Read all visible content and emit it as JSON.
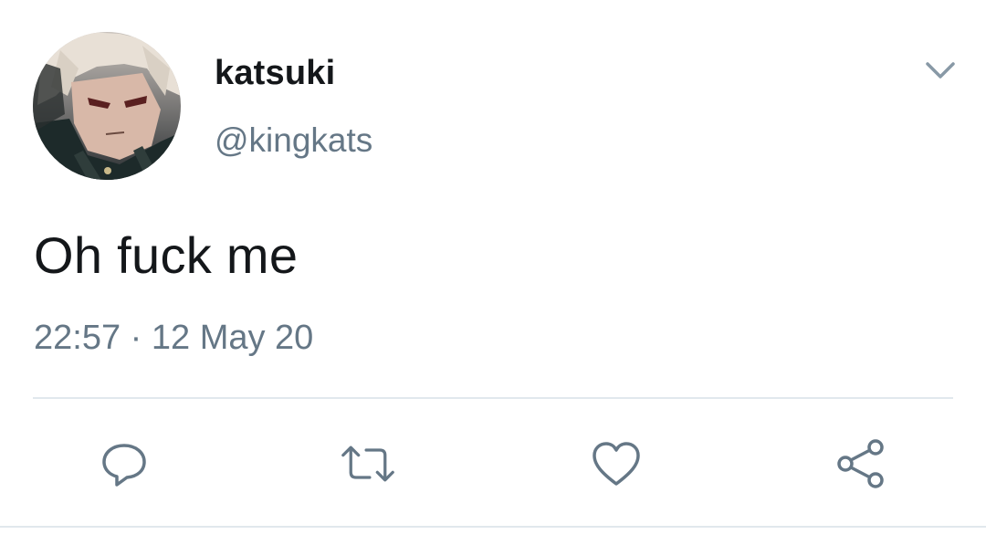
{
  "user": {
    "display_name": "katsuki",
    "handle": "@kingkats"
  },
  "tweet": {
    "text": "Oh fuck me",
    "timestamp": "22:57 · 12 May 20"
  },
  "icons": {
    "menu": "chevron-down-icon",
    "reply": "reply-icon",
    "retweet": "retweet-icon",
    "like": "heart-icon",
    "share": "share-icon"
  },
  "colors": {
    "text_primary": "#14171a",
    "text_secondary": "#657786",
    "divider": "#e1e8ed"
  }
}
